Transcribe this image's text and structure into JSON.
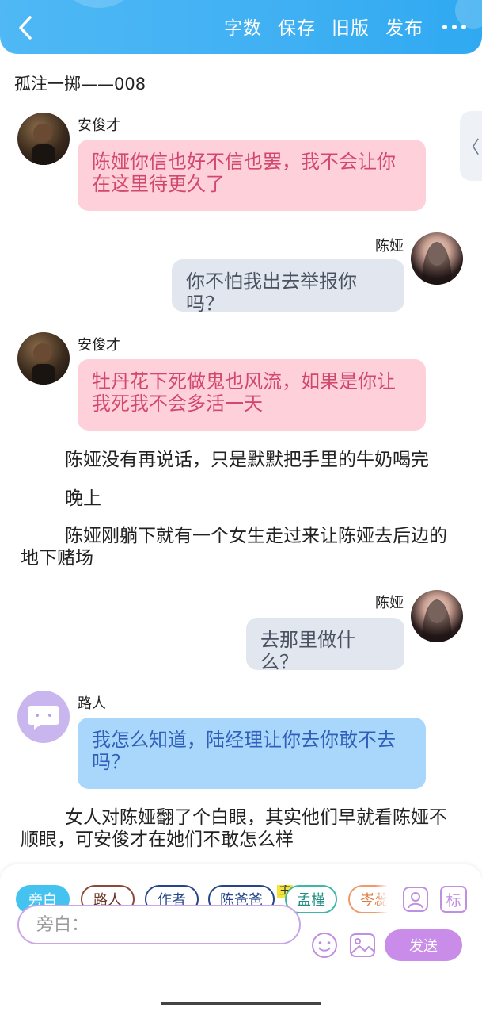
{
  "topbar": {
    "back_icon": "chevron-left-icon",
    "actions": [
      "字数",
      "保存",
      "旧版",
      "发布"
    ],
    "more_icon": "more-dots-icon"
  },
  "doc_title": "孤注一掷——008",
  "side_handle": "〈",
  "messages": [
    {
      "type": "left",
      "speaker": "安俊才",
      "avatar": "male",
      "color": "pink",
      "text": "陈娅你信也好不信也罢，我不会让你在这里待更久了"
    },
    {
      "type": "right",
      "speaker": "陈娅",
      "avatar": "female",
      "color": "gray",
      "text": "你不怕我出去举报你吗？"
    },
    {
      "type": "left",
      "speaker": "安俊才",
      "avatar": "male",
      "color": "pink",
      "text": "牡丹花下死做鬼也风流，如果是你让我死我不会多活一天"
    },
    {
      "type": "narration",
      "text": "陈娅没有再说话，只是默默把手里的牛奶喝完"
    },
    {
      "type": "narration",
      "text": "晚上"
    },
    {
      "type": "narration",
      "text": "陈娅刚躺下就有一个女生走过来让陈娅去后边的地下赌场"
    },
    {
      "type": "right",
      "speaker": "陈娅",
      "avatar": "female",
      "color": "gray",
      "text": "去那里做什么？"
    },
    {
      "type": "left",
      "speaker": "路人",
      "avatar": "guest",
      "color": "blue",
      "text": "我怎么知道，陆经理让你去你敢不去吗？"
    },
    {
      "type": "narration",
      "text": "女人对陈娅翻了个白眼，其实他们早就看陈娅不顺眼，可安俊才在她们不敢怎么样"
    }
  ],
  "composer": {
    "roles": [
      {
        "label": "旁白",
        "active": true
      },
      {
        "label": "路人",
        "active": false
      },
      {
        "label": "作者",
        "active": false
      },
      {
        "label": "陈爸爸",
        "active": false
      },
      {
        "label": "孟槿",
        "active": false,
        "tag": "主"
      },
      {
        "label": "岑蕊",
        "active": false
      }
    ],
    "icons": [
      "user-card-icon",
      "tag-icon",
      "emoji-icon",
      "image-icon"
    ],
    "tag_icon_label": "标",
    "input_placeholder": "旁白：",
    "send_label": "发送"
  }
}
